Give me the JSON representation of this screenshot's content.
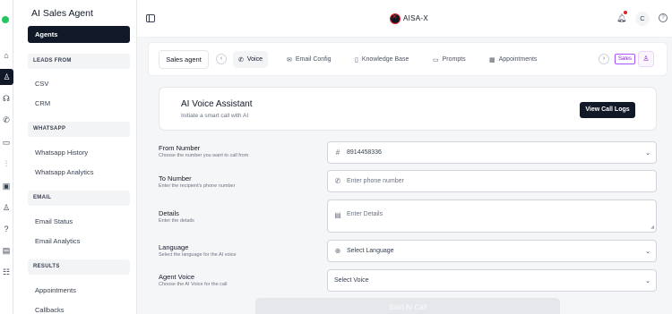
{
  "app": {
    "brand": "AISA-X",
    "sidebar_title": "AI Sales Agent"
  },
  "header": {
    "avatar_initial": "C",
    "help": "?"
  },
  "sidebar": {
    "active_item": "Agents",
    "sections": [
      {
        "title": "LEADS FROM",
        "items": [
          "CSV",
          "CRM"
        ]
      },
      {
        "title": "WHATSAPP",
        "items": [
          "Whatsapp History",
          "Whatsapp Analytics"
        ]
      },
      {
        "title": "EMAIL",
        "items": [
          "Email Status",
          "Email Analytics"
        ]
      },
      {
        "title": "RESULTS",
        "items": [
          "Appointments",
          "Callbacks"
        ]
      }
    ]
  },
  "tabbar": {
    "agent_selector": "Sales agent",
    "prev": "‹",
    "next": "›",
    "tabs": [
      {
        "label": "Voice",
        "icon": "phone-icon",
        "active": true
      },
      {
        "label": "Email Config",
        "icon": "mail-icon",
        "active": false
      },
      {
        "label": "Knowledge Base",
        "icon": "book-icon",
        "active": false
      },
      {
        "label": "Prompts",
        "icon": "message-icon",
        "active": false
      },
      {
        "label": "Appointments",
        "icon": "calendar-icon",
        "active": false
      }
    ],
    "badge": "Sales"
  },
  "assistant_card": {
    "title": "AI Voice Assistant",
    "subtitle": "Initiate a smart call with AI",
    "button": "View Call Logs"
  },
  "form": {
    "from_number": {
      "label": "From Number",
      "help": "Choose the number you want to call from",
      "value": "8914458336"
    },
    "to_number": {
      "label": "To Number",
      "help": "Enter the recipient's phone number",
      "placeholder": "Enter phone number"
    },
    "details": {
      "label": "Details",
      "help": "Enter the details",
      "placeholder": "Enter Details"
    },
    "language": {
      "label": "Language",
      "help": "Select the language for the AI voice",
      "value": "Select Language"
    },
    "agent_voice": {
      "label": "Agent Voice",
      "help": "Choose the AI Voice for the call",
      "value": "Select Voice"
    },
    "submit": "Start AI Call"
  },
  "colors": {
    "accent": "#111827",
    "status_online": "#22c55e",
    "badge": "#a855f7"
  }
}
